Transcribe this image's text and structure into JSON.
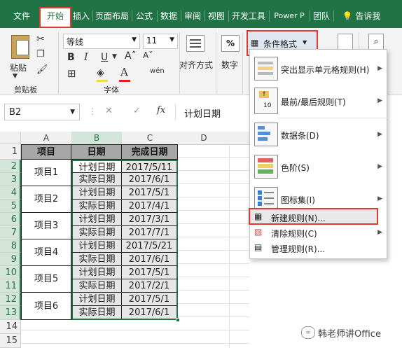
{
  "menubar": {
    "tabs": [
      {
        "label": "文件",
        "active": false
      },
      {
        "label": "开始",
        "active": true
      },
      {
        "label": "插入",
        "active": false
      },
      {
        "label": "页面布局",
        "active": false
      },
      {
        "label": "公式",
        "active": false
      },
      {
        "label": "数据",
        "active": false
      },
      {
        "label": "审阅",
        "active": false
      },
      {
        "label": "视图",
        "active": false
      },
      {
        "label": "开发工具",
        "active": false
      },
      {
        "label": "Power P",
        "active": false
      },
      {
        "label": "团队",
        "active": false
      }
    ],
    "tell_me": "告诉我",
    "accent_color": "#217346",
    "highlight_color": "#e03a30"
  },
  "ribbon": {
    "clipboard_label": "剪贴板",
    "paste_label": "粘贴",
    "font_name": "等线",
    "font_size": "11",
    "font_group_label": "字体",
    "bold": "B",
    "italic": "I",
    "underline": "U",
    "font_color_letter": "A",
    "phonetic": "wén",
    "align_label": "对齐方式",
    "number_label": "数字",
    "percent": "%",
    "conditional_format_label": "条件格式"
  },
  "formula_bar": {
    "name_box": "B2",
    "cancel": "✕",
    "confirm": "✓",
    "fx": "fx",
    "content": "计划日期"
  },
  "grid": {
    "columns": [
      "A",
      "B",
      "C",
      "D"
    ],
    "rows": [
      "1",
      "2",
      "3",
      "4",
      "5",
      "6",
      "7",
      "8",
      "9",
      "10",
      "11",
      "12",
      "13",
      "14",
      "15"
    ],
    "header": [
      "项目",
      "日期",
      "完成日期"
    ],
    "projects": [
      "项目1",
      "项目2",
      "项目3",
      "项目4",
      "项目5",
      "项目6"
    ],
    "date_rows": [
      {
        "type": "计划日期",
        "date": "2017/5/11"
      },
      {
        "type": "实际日期",
        "date": "2017/6/1"
      },
      {
        "type": "计划日期",
        "date": "2017/5/1"
      },
      {
        "type": "实际日期",
        "date": "2017/4/1"
      },
      {
        "type": "计划日期",
        "date": "2017/3/1"
      },
      {
        "type": "实际日期",
        "date": "2017/7/1"
      },
      {
        "type": "计划日期",
        "date": "2017/5/21"
      },
      {
        "type": "实际日期",
        "date": "2017/6/1"
      },
      {
        "type": "计划日期",
        "date": "2017/5/1"
      },
      {
        "type": "实际日期",
        "date": "2017/2/1"
      },
      {
        "type": "计划日期",
        "date": "2017/5/1"
      },
      {
        "type": "实际日期",
        "date": "2017/6/1"
      }
    ]
  },
  "dropdown": {
    "items": [
      {
        "label": "突出显示单元格规则(H)",
        "arrow": "▶"
      },
      {
        "label": "最前/最后规则(T)",
        "arrow": "▶"
      },
      {
        "label": "数据条(D)",
        "arrow": "▶"
      },
      {
        "label": "色阶(S)",
        "arrow": "▶"
      },
      {
        "label": "图标集(I)",
        "arrow": "▶"
      }
    ],
    "small_items": [
      {
        "label": "新建规则(N)...",
        "arrow": ""
      },
      {
        "label": "清除规则(C)",
        "arrow": "▶"
      },
      {
        "label": "管理规则(R)...",
        "arrow": ""
      }
    ]
  },
  "watermark": "韩老师讲Office"
}
